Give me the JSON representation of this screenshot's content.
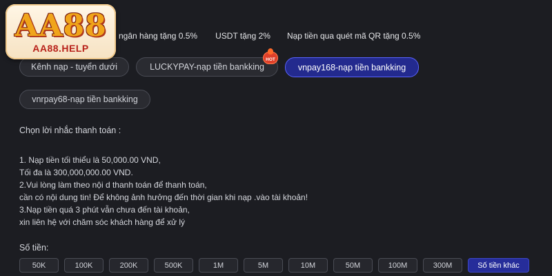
{
  "logo": {
    "main": "AA88",
    "sub": "AA88.HELP"
  },
  "promo_tabs": [
    "ngân hàng tặng 0.5%",
    "USDT tặng 2%",
    "Nạp tiền qua quét mã QR tặng 0.5%"
  ],
  "channels": [
    {
      "label": "Kênh nạp - tuyển dưới",
      "active": false
    },
    {
      "label": "LUCKYPAY-nạp tiền bankking",
      "active": false,
      "badge": "HOT"
    },
    {
      "label": "vnpay168-nạp tiền bankking",
      "active": true
    },
    {
      "label": "vnrpay68-nạp tiền bankking",
      "active": false
    }
  ],
  "reminder": {
    "title": "Chọn lời nhắc thanh toán :",
    "lines": [
      "1. Nạp tiền tối thiểu là 50,000.00 VND,",
      "Tối đa là 300,000,000.00 VND.",
      "2.Vui lòng làm theo nội d thanh toán để thanh toán,",
      "cần có nội dung tin! Để không ảnh hưởng đến thời gian khi nạp .vào tài khoản!",
      "3.Nạp tiền quá 3 phút vẫn chưa đến tài khoản,",
      "xin liên hệ với chăm sóc khách hàng để xử lý"
    ]
  },
  "amount": {
    "label": "Số tiền:",
    "options": [
      "50K",
      "100K",
      "200K",
      "500K",
      "1M",
      "5M",
      "10M",
      "50M",
      "100M",
      "300M"
    ],
    "other_label": "Số tiền khác"
  },
  "colors": {
    "background": "#1c1d22",
    "active_pill": "#232a8e",
    "active_border": "#5a63ff",
    "other_button": "#262d9a",
    "hot_badge": "#e0402a",
    "logo_gold": "#f0a51a",
    "logo_red": "#b8211a"
  }
}
